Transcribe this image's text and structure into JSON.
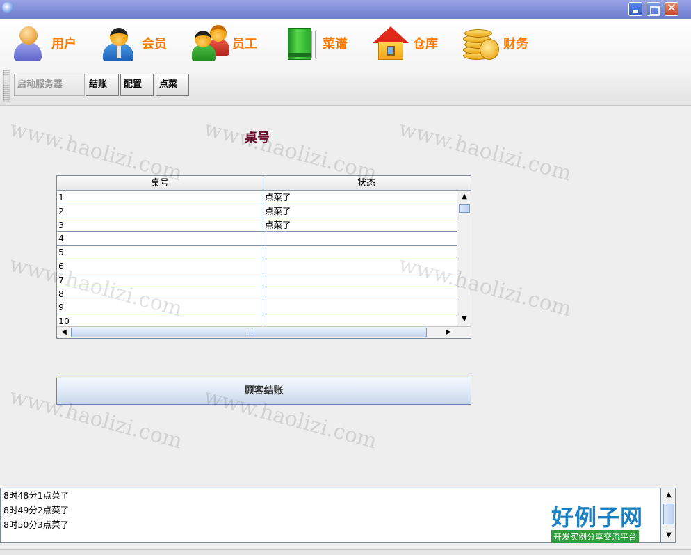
{
  "window": {
    "controls": [
      "minimize",
      "maximize",
      "close"
    ],
    "close_glyph": "✕"
  },
  "menu": [
    {
      "label": "用户",
      "icon": "user-icon"
    },
    {
      "label": "会员",
      "icon": "member-icon"
    },
    {
      "label": "员工",
      "icon": "staff-icon"
    },
    {
      "label": "菜谱",
      "icon": "recipe-book-icon"
    },
    {
      "label": "仓库",
      "icon": "warehouse-icon"
    },
    {
      "label": "财务",
      "icon": "finance-coins-icon"
    }
  ],
  "toolbar": {
    "start_server": "启动服务器",
    "checkout": "结账",
    "config": "配置",
    "order": "点菜"
  },
  "main": {
    "title": "桌号",
    "table": {
      "headers": [
        "桌号",
        "状态"
      ],
      "rows": [
        [
          "1",
          "点菜了"
        ],
        [
          "2",
          "点菜了"
        ],
        [
          "3",
          "点菜了"
        ],
        [
          "4",
          ""
        ],
        [
          "5",
          ""
        ],
        [
          "6",
          ""
        ],
        [
          "7",
          ""
        ],
        [
          "8",
          ""
        ],
        [
          "9",
          ""
        ],
        [
          "10",
          ""
        ]
      ]
    },
    "checkout_button": "顾客结账"
  },
  "log": {
    "lines": [
      "8时48分1点菜了",
      "8时49分2点菜了",
      "8时50分3点菜了"
    ]
  },
  "watermark": {
    "text": "www.haolizi.com",
    "brand_title": "好例子网",
    "brand_subtitle": "开发实例分享交流平台"
  },
  "colors": {
    "menu_label": "#ff7a00",
    "title": "#6e1030",
    "titlebar": "#7b89d6"
  }
}
